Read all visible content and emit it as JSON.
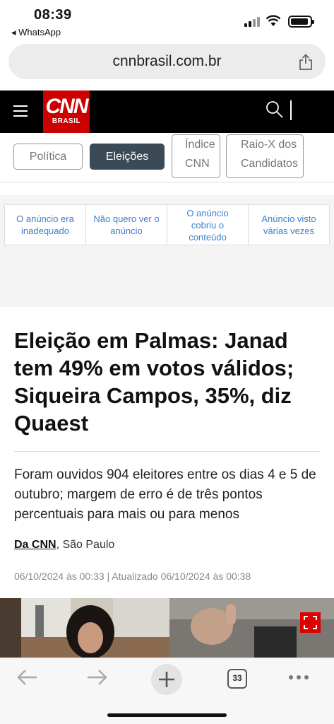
{
  "status_bar": {
    "time": "08:39",
    "back_app": "◂ WhatsApp"
  },
  "browser": {
    "url": "cnnbrasil.com.br",
    "tab_count": "33"
  },
  "site": {
    "logo_main": "CNN",
    "logo_sub": "BRASIL"
  },
  "tabs": [
    {
      "label": "Política"
    },
    {
      "label": "Eleições"
    },
    {
      "label": "Índice CNN"
    },
    {
      "label": "Raio-X dos Candidatos"
    }
  ],
  "ad_feedback": [
    {
      "label": "O anúncio era inadequado"
    },
    {
      "label": "Não quero ver o anúncio"
    },
    {
      "label": "O anúncio cobriu o conteúdo"
    },
    {
      "label": "Anúncio visto várias vezes"
    }
  ],
  "article": {
    "headline": "Eleição em Palmas: Janad tem 49% em votos válidos; Siqueira Campos, 35%, diz Quaest",
    "lede": "Foram ouvidos 904 eleitores entre os dias 4 e 5 de outubro; margem de erro é de três pontos percentuais para mais ou para menos",
    "byline_source": "Da CNN",
    "byline_place": ", São Paulo",
    "dates": "06/10/2024 às 00:33 | Atualizado 06/10/2024 às 00:38"
  },
  "colors": {
    "brand_red": "#cc0000",
    "active_tab": "#3b4a55",
    "link_blue": "#3f7fd0"
  }
}
